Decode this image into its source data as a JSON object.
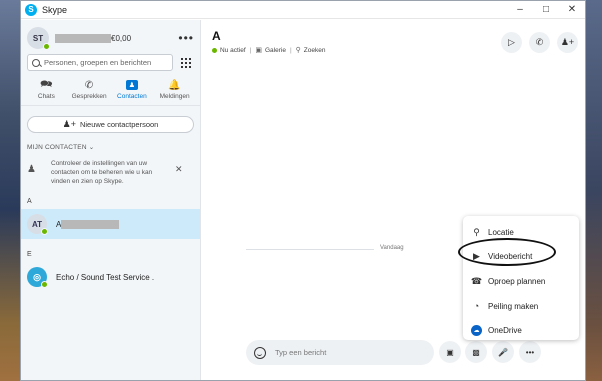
{
  "window": {
    "title": "Skype"
  },
  "profile": {
    "initials": "ST",
    "balance": "€0,00"
  },
  "search": {
    "placeholder": "Personen, groepen en berichten"
  },
  "nav": [
    {
      "label": "Chats"
    },
    {
      "label": "Gesprekken"
    },
    {
      "label": "Contacten"
    },
    {
      "label": "Meldingen"
    }
  ],
  "new_contact_label": "Nieuwe contactpersoon",
  "section_title": "MIJN CONTACTEN",
  "notice_text": "Controleer de instellingen van uw contacten om te beheren wie u kan vinden en zien op Skype.",
  "groups": [
    {
      "letter": "A",
      "contact": {
        "initials": "AT",
        "name": "A"
      }
    },
    {
      "letter": "E",
      "contact": {
        "name": "Echo / Sound Test Service ."
      }
    }
  ],
  "chat": {
    "title": "A",
    "status": "Nu actief",
    "gallery": "Galerie",
    "find": "Zoeken",
    "date_divider": "Vandaag",
    "composer_placeholder": "Typ een bericht"
  },
  "menu": [
    {
      "label": "Locatie",
      "icon": "location-icon"
    },
    {
      "label": "Videobericht",
      "icon": "video-message-icon"
    },
    {
      "label": "Oproep plannen",
      "icon": "schedule-call-icon"
    },
    {
      "label": "Peiling maken",
      "icon": "poll-icon"
    },
    {
      "label": "OneDrive",
      "icon": "onedrive-icon"
    }
  ],
  "colors": {
    "accent": "#0078d4",
    "presence": "#6bb700",
    "selected_row": "#cdeafa"
  }
}
